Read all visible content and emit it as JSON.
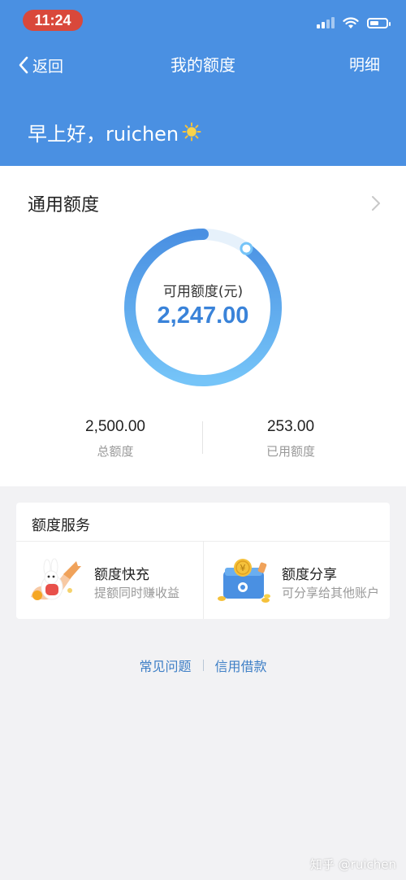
{
  "status_bar": {
    "time": "11:24"
  },
  "nav": {
    "back_label": "返回",
    "title": "我的额度",
    "detail_label": "明细"
  },
  "greeting": {
    "text": "早上好，ruichen"
  },
  "quota": {
    "title": "通用额度",
    "ring_label": "可用额度(元)",
    "available": "2,247.00",
    "total_value": "2,500.00",
    "total_label": "总额度",
    "used_value": "253.00",
    "used_label": "已用额度",
    "available_fraction": 0.8988
  },
  "services": {
    "title": "额度服务",
    "items": [
      {
        "name": "额度快充",
        "desc": "提额同时赚收益",
        "icon": "rabbit-rocket-illustration"
      },
      {
        "name": "额度分享",
        "desc": "可分享给其他账户",
        "icon": "wallet-coins-illustration"
      }
    ]
  },
  "links": {
    "faq": "常见问题",
    "credit": "信用借款"
  },
  "watermark": "知乎 @ruichen",
  "colors": {
    "brand_blue": "#4a90e2",
    "ring_start": "#4a90e2",
    "ring_end": "#75c4f8",
    "ring_track": "#e6f1fb"
  }
}
